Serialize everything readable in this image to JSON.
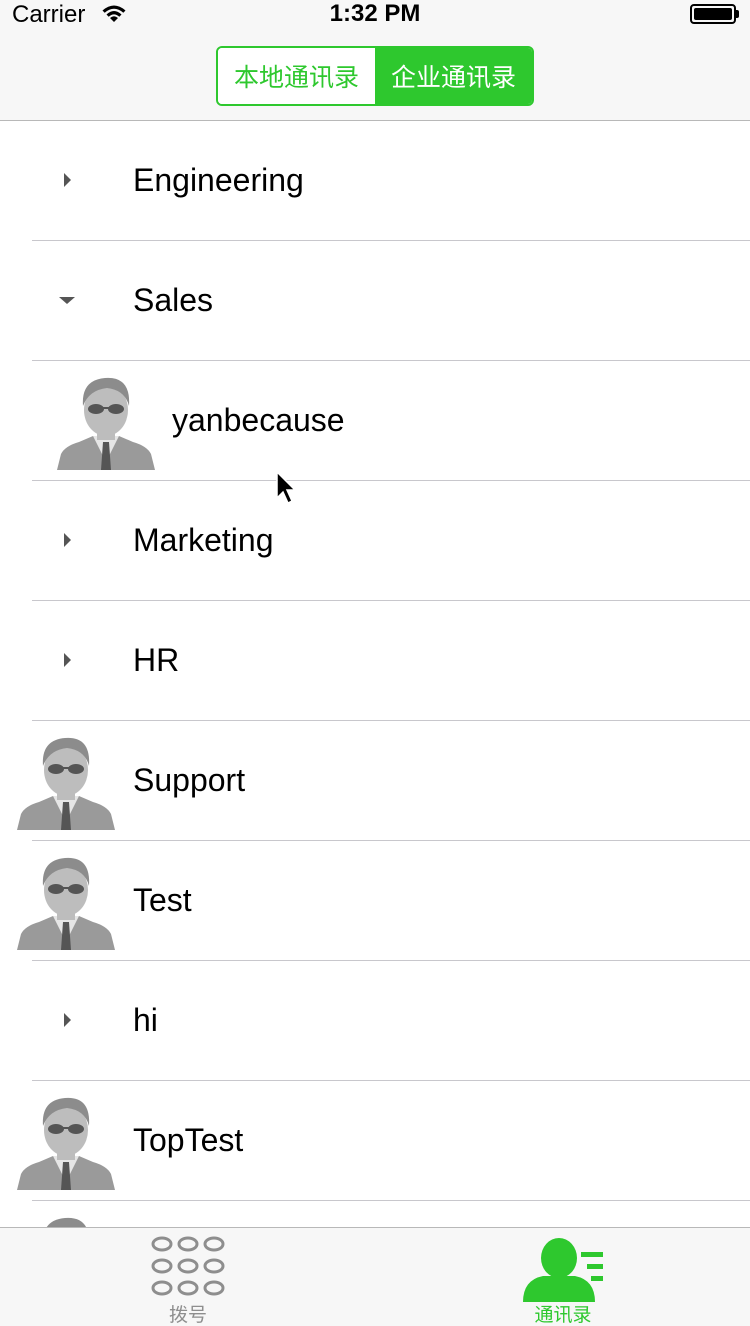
{
  "status_bar": {
    "carrier": "Carrier",
    "time": "1:32 PM",
    "wifi_icon": "wifi-icon",
    "battery_icon": "battery-icon"
  },
  "segmented_control": {
    "options": [
      "本地通讯录",
      "企业通讯录"
    ],
    "selected": "企业通讯录",
    "accent_color": "#2ec82e"
  },
  "contacts": {
    "rows": [
      {
        "label": "Engineering",
        "type": "group",
        "expanded": false
      },
      {
        "label": "Sales",
        "type": "group",
        "expanded": true
      },
      {
        "label": "yanbecause",
        "type": "member"
      },
      {
        "label": "Marketing",
        "type": "group",
        "expanded": false
      },
      {
        "label": "HR",
        "type": "group",
        "expanded": false
      },
      {
        "label": "Support",
        "type": "contact"
      },
      {
        "label": "Test",
        "type": "contact"
      },
      {
        "label": "hi",
        "type": "group",
        "expanded": false
      },
      {
        "label": "TopTest",
        "type": "contact"
      }
    ]
  },
  "tab_bar": {
    "tabs": [
      {
        "label": "拨号",
        "icon": "dialpad-icon",
        "selected": false
      },
      {
        "label": "通讯录",
        "icon": "contacts-icon",
        "selected": true
      }
    ],
    "active_color": "#2ec82e",
    "inactive_color": "#8e8e8e"
  }
}
